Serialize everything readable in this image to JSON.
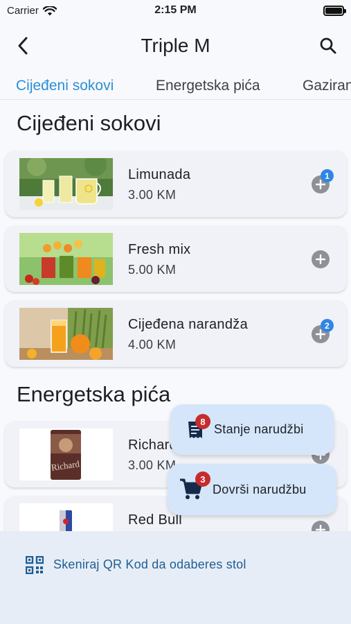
{
  "status_bar": {
    "carrier": "Carrier",
    "time": "2:15 PM"
  },
  "header": {
    "title": "Triple M",
    "back_icon": "chevron-left-icon",
    "search_icon": "search-icon"
  },
  "tabs": [
    {
      "label": "Cijeđeni sokovi",
      "active": true
    },
    {
      "label": "Energetska pića",
      "active": false
    },
    {
      "label": "Gaziran",
      "active": false
    }
  ],
  "sections": [
    {
      "title": "Cijeđeni sokovi",
      "items": [
        {
          "name": "Limunada",
          "price": "3.00 KM",
          "badge": "1"
        },
        {
          "name": "Fresh mix",
          "price": "5.00 KM",
          "badge": ""
        },
        {
          "name": "Cijeđena narandža",
          "price": "4.00 KM",
          "badge": "2"
        }
      ]
    },
    {
      "title": "Energetska pića",
      "items": [
        {
          "name": "Richard",
          "price": "3.00 KM",
          "badge": ""
        },
        {
          "name": "Red Bull",
          "price": "",
          "badge": ""
        }
      ]
    }
  ],
  "fabs": {
    "order_status": {
      "label": "Stanje narudžbi",
      "badge": "8"
    },
    "finish_order": {
      "label": "Dovrši narudžbu",
      "badge": "3"
    }
  },
  "bottom": {
    "qr_label": "Skeniraj QR Kod da odaberes stol"
  },
  "colors": {
    "accent": "#2a8fd4",
    "badge_red": "#c82b2b",
    "badge_blue": "#2f86e4",
    "fab_bg": "#d5e6fb"
  }
}
